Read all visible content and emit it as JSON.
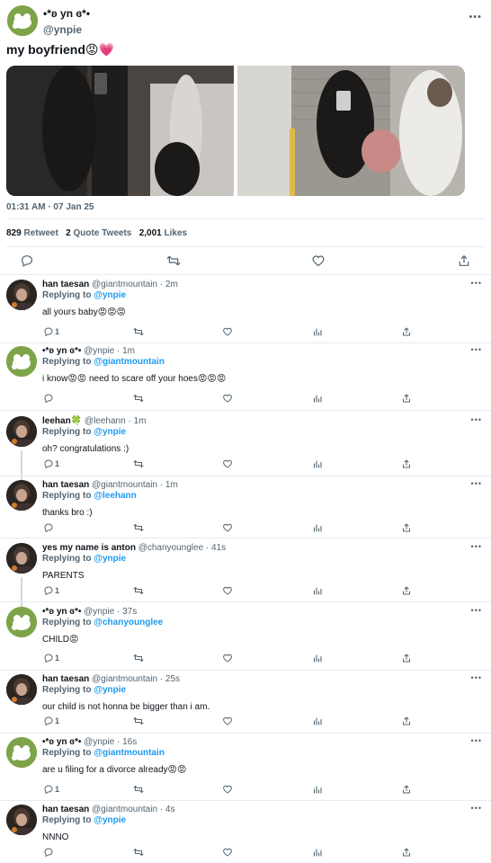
{
  "main_tweet": {
    "display_name": "•*ʚ yn ɞ*•",
    "handle": "@ynpie",
    "text": "my boyfriend😡💗",
    "timestamp": "01:31 AM · 07 Jan 25",
    "stats": {
      "retweets": "829",
      "retweets_label": "Retweet",
      "quotes": "2",
      "quotes_label": "Quote Tweets",
      "likes": "2,001",
      "likes_label": "Likes"
    },
    "more_icon": "more-dots-icon"
  },
  "replies": [
    {
      "name": "han taesan",
      "meta": "@giantmountain · 2m",
      "replying_label": "Replying to",
      "replying_to": "@ynpie",
      "text": "all yours baby😡😡😡",
      "reply_count": "1",
      "avatar": "dark"
    },
    {
      "name": "•*ʚ yn ɞ*•",
      "meta": "@ynpie · 1m",
      "replying_label": "Replying to",
      "replying_to": "@giantmountain",
      "text": "i know😡😡  need to scare off your hoes😡😡😡",
      "reply_count": "",
      "avatar": "green"
    },
    {
      "name": "leehan🍀",
      "meta": "@leehann · 1m",
      "replying_label": "Replying to",
      "replying_to": "@ynpie",
      "text": "oh? congratulations :)",
      "reply_count": "1",
      "avatar": "dark"
    },
    {
      "name": "han taesan",
      "meta": "@giantmountain · 1m",
      "replying_label": "Replying to",
      "replying_to": "@leehann",
      "text": "thanks bro :)",
      "reply_count": "",
      "avatar": "dark"
    },
    {
      "name": "yes my name is anton",
      "meta": "@chanyounglee · 41s",
      "replying_label": "Replying to",
      "replying_to": "@ynpie",
      "text": "PARENTS",
      "reply_count": "1",
      "avatar": "dark"
    },
    {
      "name": "•*ʚ yn ɞ*•",
      "meta": "@ynpie · 37s",
      "replying_label": "Replying to",
      "replying_to": "@chanyounglee",
      "text": "CHILD😡",
      "reply_count": "1",
      "avatar": "green"
    },
    {
      "name": "han taesan",
      "meta": "@giantmountain · 25s",
      "replying_label": "Replying to",
      "replying_to": "@ynpie",
      "text": "our child is not honna be bigger than i am.",
      "reply_count": "1",
      "avatar": "dark"
    },
    {
      "name": "•*ʚ yn ɞ*•",
      "meta": "@ynpie · 16s",
      "replying_label": "Replying to",
      "replying_to": "@giantmountain",
      "text": "are u filing for a divorce already😡😡",
      "reply_count": "1",
      "avatar": "green"
    },
    {
      "name": "han taesan",
      "meta": "@giantmountain · 4s",
      "replying_label": "Replying to",
      "replying_to": "@ynpie",
      "text": "NNNO",
      "reply_count": "",
      "avatar": "dark"
    }
  ],
  "icons": {
    "reply": "reply-icon",
    "retweet": "retweet-icon",
    "like": "heart-icon",
    "analytics": "analytics-icon",
    "share": "share-icon"
  },
  "colors": {
    "mention": "#1d9bf0",
    "secondary_text": "#536471",
    "divider": "#e6ecf0"
  }
}
